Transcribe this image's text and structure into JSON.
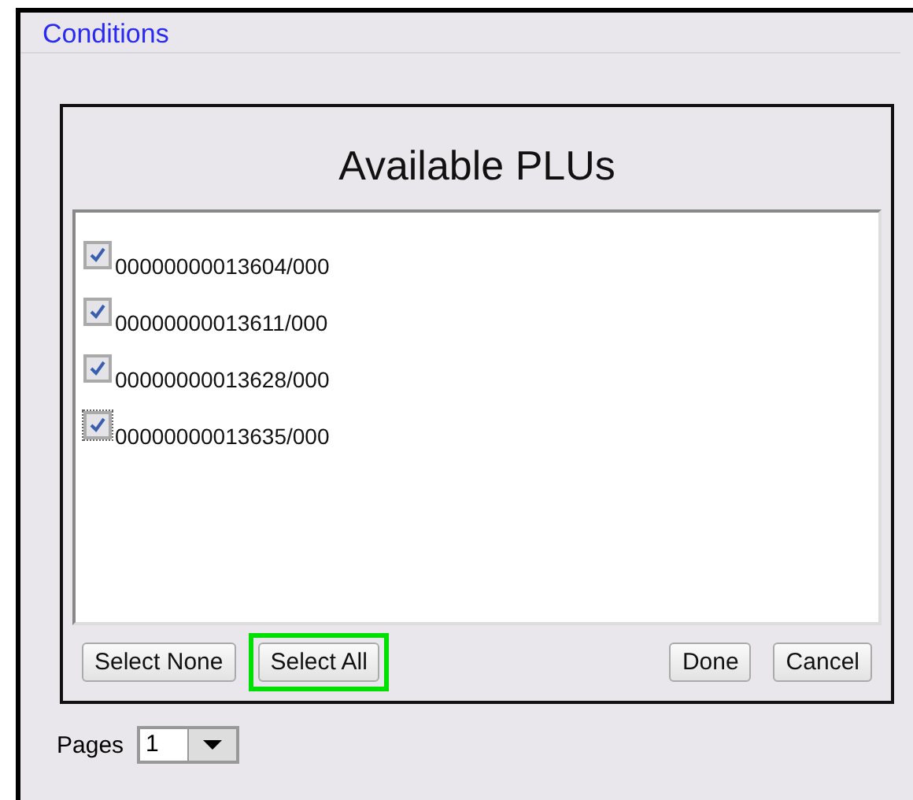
{
  "section_link": "Conditions",
  "dialog": {
    "title": "Available PLUs",
    "items": [
      {
        "label": "00000000013604/000",
        "checked": true,
        "focused": false
      },
      {
        "label": "00000000013611/000",
        "checked": true,
        "focused": false
      },
      {
        "label": "00000000013628/000",
        "checked": true,
        "focused": false
      },
      {
        "label": "00000000013635/000",
        "checked": true,
        "focused": true
      }
    ],
    "left_buttons": [
      {
        "label": "Select None",
        "highlighted": false
      },
      {
        "label": "Select All",
        "highlighted": true
      }
    ],
    "right_buttons": [
      {
        "label": "Done",
        "highlighted": false
      },
      {
        "label": "Cancel",
        "highlighted": false
      }
    ]
  },
  "pages": {
    "label": "Pages",
    "value": "1"
  }
}
